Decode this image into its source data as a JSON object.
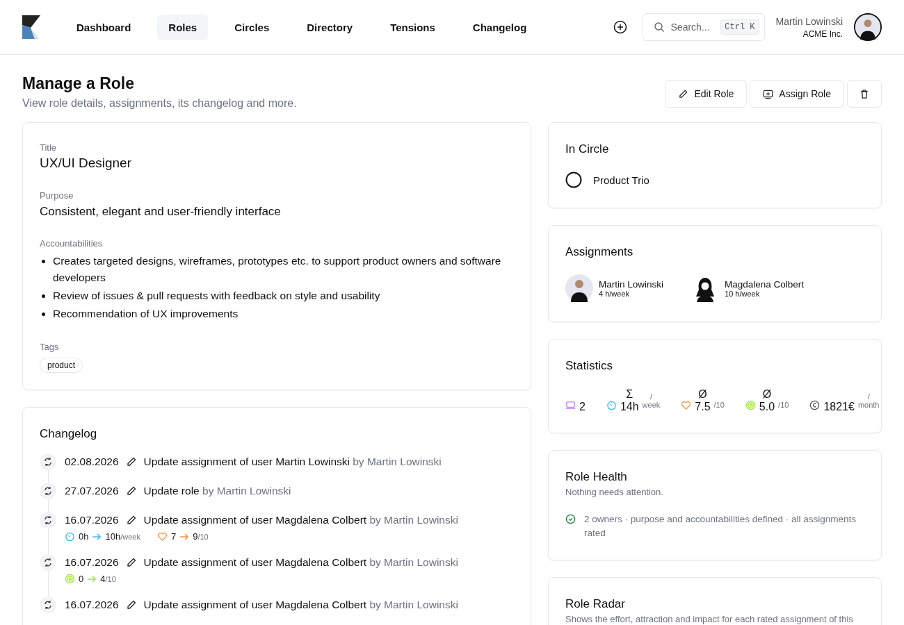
{
  "nav": [
    {
      "label": "Dashboard",
      "selected": false
    },
    {
      "label": "Roles",
      "selected": true
    },
    {
      "label": "Circles",
      "selected": false
    },
    {
      "label": "Directory",
      "selected": false
    },
    {
      "label": "Tensions",
      "selected": false
    },
    {
      "label": "Changelog",
      "selected": false
    }
  ],
  "search": {
    "placeholder": "Search...",
    "shortcut": "Ctrl K"
  },
  "user": {
    "name": "Martin Lowinski",
    "company": "ACME Inc."
  },
  "page": {
    "title": "Manage a Role",
    "subtitle": "View role details, assignments, its changelog and more.",
    "actions": [
      {
        "kind": "edit",
        "label": "Edit Role"
      },
      {
        "kind": "assign",
        "label": "Assign Role"
      },
      {
        "kind": "delete"
      }
    ]
  },
  "role": {
    "title_label": "Title",
    "title": "UX/UI Designer",
    "purpose_label": "Purpose",
    "purpose": "Consistent, elegant and user-friendly interface",
    "accountabilities_label": "Accountabilities",
    "accountabilities": [
      "Creates targeted designs, wireframes, prototypes etc. to support product owners and software developers",
      "Review of issues & pull requests with feedback on style and usability",
      "Recommendation of UX improvements"
    ],
    "tags_label": "Tags",
    "tags": [
      "product"
    ]
  },
  "changelog": {
    "title": "Changelog",
    "entries": [
      {
        "date": "02.08.2026",
        "action": "Update assignment of user Martin Lowinski",
        "by": "by Martin Lowinski"
      },
      {
        "date": "27.07.2026",
        "action": "Update role",
        "by": "by Martin Lowinski"
      },
      {
        "date": "16.07.2026",
        "action": "Update assignment of user Magdalena Colbert",
        "by": "by Martin Lowinski",
        "changes": [
          {
            "kind": "effort",
            "from": "0h",
            "to": "10h",
            "unit": "/week"
          },
          {
            "kind": "attraction",
            "from": "7",
            "to": "9",
            "unit": "/10"
          }
        ]
      },
      {
        "date": "16.07.2026",
        "action": "Update assignment of user Magdalena Colbert",
        "by": "by Martin Lowinski",
        "changes": [
          {
            "kind": "impact",
            "from": "0",
            "to": "4",
            "unit": "/10"
          }
        ]
      },
      {
        "date": "16.07.2026",
        "action": "Update assignment of user Magdalena Colbert",
        "by": "by Martin Lowinski"
      }
    ]
  },
  "circle": {
    "title": "In Circle",
    "name": "Product Trio"
  },
  "assignments": {
    "title": "Assignments",
    "people": [
      {
        "name": "Martin Lowinski",
        "hours": "4 h/week",
        "kind": "man"
      },
      {
        "name": "Magdalena Colbert",
        "hours": "10 h/week",
        "kind": "woman"
      }
    ]
  },
  "statistics": {
    "title": "Statistics",
    "items": [
      {
        "kind": "count",
        "value": "2"
      },
      {
        "kind": "effort",
        "symbol": "Σ",
        "value": "14h",
        "slash": "/",
        "unit": "week"
      },
      {
        "kind": "attraction",
        "symbol": "Ø",
        "value": "7.5",
        "unit": "/10"
      },
      {
        "kind": "impact",
        "symbol": "Ø",
        "value": "5.0",
        "unit": "/10"
      },
      {
        "kind": "cost",
        "value": "1821€",
        "slash": "/",
        "unit": "month"
      }
    ]
  },
  "health": {
    "title": "Role Health",
    "subtitle": "Nothing needs attention.",
    "ok": true,
    "message": "2 owners · purpose and accountabilities defined · all assignments rated"
  },
  "radar": {
    "title": "Role Radar",
    "subtitle": "Shows the effort, attraction and impact for each rated assignment of this"
  }
}
